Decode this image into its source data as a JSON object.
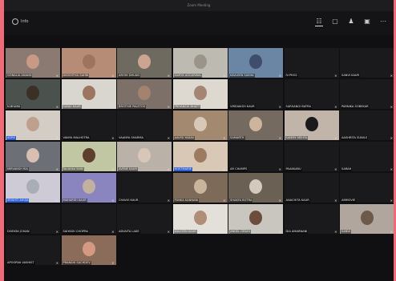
{
  "window": {
    "title": "Zoom Meeting"
  },
  "toolbar": {
    "info_label": "Info"
  },
  "participants": [
    {
      "name": "GONALIA ANAND",
      "bg": "#8b7a72",
      "face": "#c89a85"
    },
    {
      "name": "DIKSHITHA SAHNI",
      "bg": "#b68c76",
      "face": "#a0735f"
    },
    {
      "name": "AROHI DHUAN",
      "bg": "#6f6a5f",
      "face": "#cba591"
    },
    {
      "name": "KAMYA AGGARWAL",
      "bg": "#bdbab2",
      "face": "#9a948b"
    },
    {
      "name": "KAVLEEN SASHA",
      "bg": "#6b86a5",
      "face": "#3d4d6b"
    },
    {
      "name": "IV.PHO2",
      "bg": "#1a1a1c",
      "face": "#1a1a1c"
    },
    {
      "name": "SANVI KAUR",
      "bg": "#1a1a1c",
      "face": "#1a1a1c"
    },
    {
      "name": "Aahnir Kaur Dhupar",
      "bg": "#c7a290",
      "face": "#e26d76"
    },
    {
      "name": "N.BHARA",
      "bg": "#4b514d",
      "face": "#3a3025"
    },
    {
      "name": "SANJU KAUR",
      "bg": "#d9d6cf",
      "face": "#9c7560"
    },
    {
      "name": "BROTHIE PALETOS",
      "bg": "#7d7069",
      "face": "#a4826f"
    },
    {
      "name": "PRIYANSHI BHATT",
      "bg": "#ddd9d1",
      "face": "#a58474"
    },
    {
      "name": "VIRDIAKSH KAUR",
      "bg": "#1a1a1c",
      "face": "#1a1a1c"
    },
    {
      "name": "SARSANGI BATRA",
      "bg": "#1a1a1c",
      "face": "#1a1a1c"
    },
    {
      "name": "PARNIKA SOBEKAR",
      "bg": "#1a1a1c",
      "face": "#1a1a1c"
    },
    {
      "name": "YASHAKSH NANDA",
      "bg": "#cbb6a6",
      "face": "#8a6552"
    },
    {
      "name": "AGRE",
      "bg": "#d3cdc6",
      "face": "#bfa08c",
      "hl": true
    },
    {
      "name": "VANYA MALHOTRA",
      "bg": "#1a1a1c",
      "face": "#1a1a1c"
    },
    {
      "name": "VAANYA SHARMA",
      "bg": "#1a1a1c",
      "face": "#1a1a1c"
    },
    {
      "name": "AAVYA YADAV",
      "bg": "#a3896f",
      "face": "#d8c8b8"
    },
    {
      "name": "SAMARTH",
      "bg": "#756a5f",
      "face": "#cdb49c"
    },
    {
      "name": "SAMMY MEHTA",
      "bg": "#c0b5a8",
      "face": "#1a1a1c"
    },
    {
      "name": "AASHRITA SUNILS",
      "bg": "#1a1a1c",
      "face": "#1a1a1c"
    },
    {
      "name": "NEELEN KAUR",
      "bg": "#4a5464",
      "face": "#2c2a26"
    },
    {
      "name": "MIRVANSH RAI",
      "bg": "#6d6f77",
      "face": "#d8bfb1"
    },
    {
      "name": "Tanishka Sethi",
      "bg": "#c0c7a2",
      "face": "#5e3e2d"
    },
    {
      "name": "AVENE KAUR",
      "bg": "#bab1a8",
      "face": "#d8c6b8"
    },
    {
      "name": "HOSTMARIE",
      "bg": "#d9c8b5",
      "face": "#9d7b61",
      "hl": true
    },
    {
      "name": "AR CHAMPS",
      "bg": "#1a1a1c",
      "face": "#1a1a1c"
    },
    {
      "name": "PAAKKARU",
      "bg": "#1a1a1c",
      "face": "#1a1a1c"
    },
    {
      "name": "SARAH",
      "bg": "#1a1a1c",
      "face": "#1a1a1c"
    },
    {
      "name": "NIMYA",
      "bg": "#cdc8d3",
      "face": "#a27f6c"
    },
    {
      "name": "SRISHTI AHUJA",
      "bg": "#cfcbd6",
      "face": "#a8adb6",
      "hl": true
    },
    {
      "name": "MAHARSH KAUR",
      "bg": "#8a84bf",
      "face": "#c2b0a1"
    },
    {
      "name": "CHAVVI KAUR",
      "bg": "#1a1a1c",
      "face": "#1a1a1c"
    },
    {
      "name": "PUNKA KANNANI",
      "bg": "#7d6a58",
      "face": "#c9b59b"
    },
    {
      "name": "SHAKYA BOTRA",
      "bg": "#6a6054",
      "face": "#d4c9bd"
    },
    {
      "name": "ANACHITA KAUR",
      "bg": "#1a1a1c",
      "face": "#1a1a1c"
    },
    {
      "name": "AMMOVIE",
      "bg": "#1a1a1c",
      "face": "#1a1a1c"
    },
    {
      "name": "SINGH",
      "bg": "#c0b9b1",
      "face": "#8c715f"
    },
    {
      "name": "DIVEKNI JOHAN",
      "bg": "#1a1a1c",
      "face": "#1a1a1c"
    },
    {
      "name": "SAIYASH CHOPRA",
      "bg": "#1a1a1c",
      "face": "#1a1a1c"
    },
    {
      "name": "ADVAITA LAKE",
      "bg": "#1a1a1c",
      "face": "#1a1a1c"
    },
    {
      "name": "KAVLEEN KAUR",
      "bg": "#e3e0da",
      "face": "#b08d77"
    },
    {
      "name": "ANGEL GRAHI",
      "bg": "#c9c6c0",
      "face": "#6c4c3b"
    },
    {
      "name": "DIA AMARNANI",
      "bg": "#1a1a1c",
      "face": "#1a1a1c"
    },
    {
      "name": "SANVI",
      "bg": "#b0a69d",
      "face": "#6d5a4b"
    },
    {
      "name": "KAVLEEN KAUR",
      "bg": "#1a1a1c",
      "face": "#1a1a1c"
    },
    {
      "name": "APOORVA VASHIST",
      "bg": "#1a1a1c",
      "face": "#1a1a1c"
    },
    {
      "name": "PRANSHI SACHDEV",
      "bg": "#8b6c5a",
      "face": "#d49980"
    }
  ]
}
